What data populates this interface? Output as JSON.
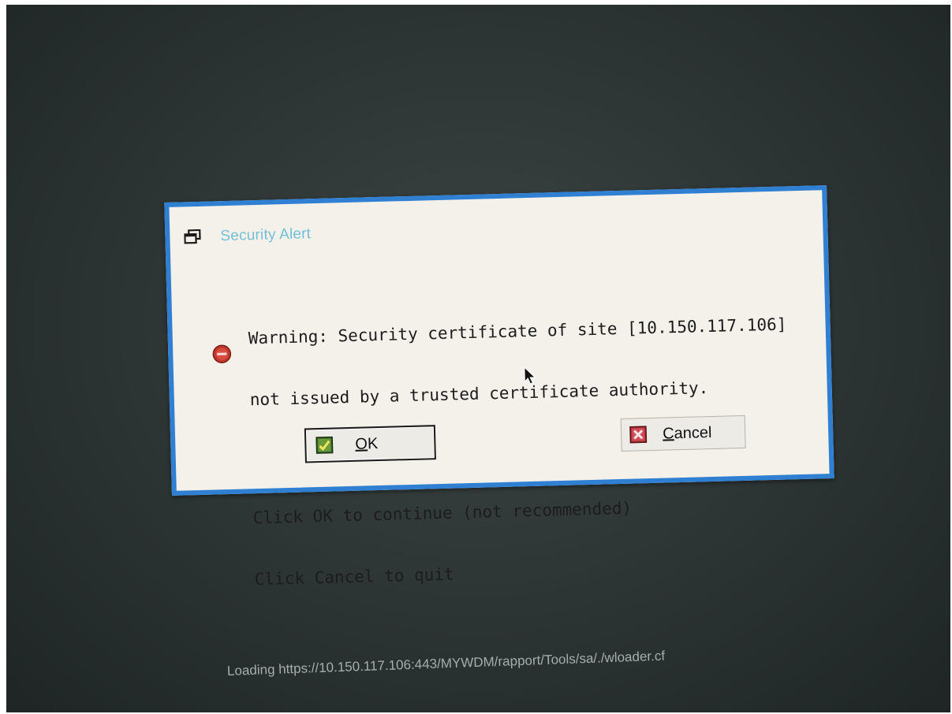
{
  "dialog": {
    "title": "Security Alert",
    "window_icon": "window-icon",
    "status_icon": "stop-icon",
    "message_line1": "Warning: Security certificate of site [10.150.117.106]",
    "message_line2": "not issued by a trusted certificate authority.",
    "message_line3": "Click OK to continue (not recommended)",
    "message_line4": "Click Cancel to quit",
    "ok_button": {
      "mnemonic": "O",
      "rest": "K",
      "icon": "check-icon"
    },
    "cancel_button": {
      "mnemonic": "C",
      "rest": "ancel",
      "icon": "cross-icon"
    }
  },
  "status_bar": {
    "text": "Loading https://10.150.117.106:443/MYWDM/rapport/Tools/sa/./wloader.cf"
  },
  "colors": {
    "dialog_border": "#2f7fd2",
    "title_text": "#74bfd8",
    "dialog_bg": "#f3f1ea",
    "screen_bg": "#2c3333"
  }
}
